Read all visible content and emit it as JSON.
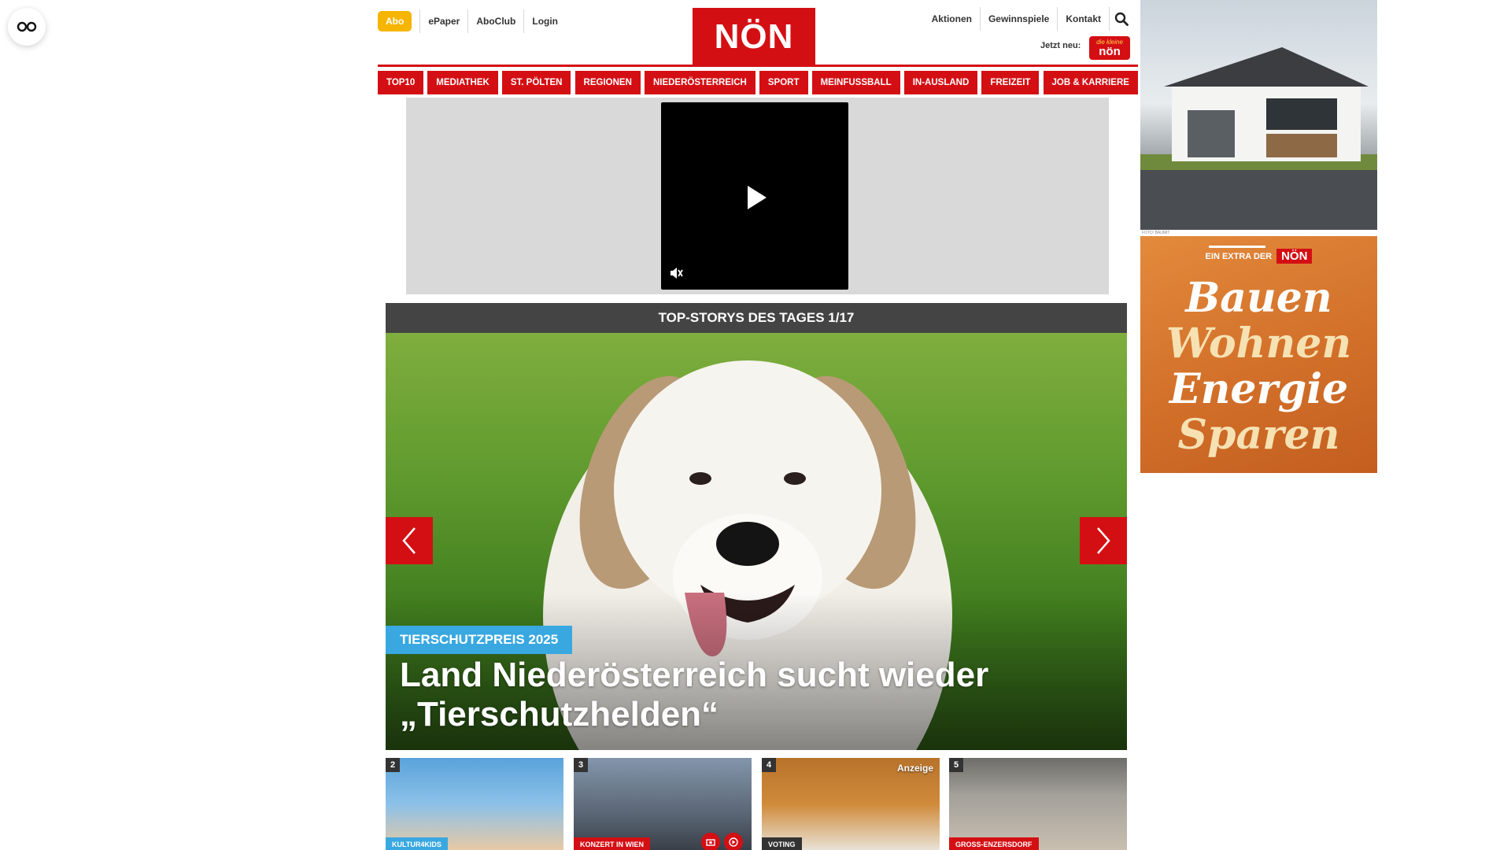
{
  "header": {
    "abo_label": "Abo",
    "top_links": [
      "ePaper",
      "AboClub",
      "Login"
    ],
    "logo_text": "NÖN",
    "right_links": [
      "Aktionen",
      "Gewinnspiele",
      "Kontakt"
    ],
    "jetzt_neu": "Jetzt neu:",
    "badge_small": "die kleine",
    "badge_big": "nön"
  },
  "nav": {
    "items": [
      "TOP10",
      "MEDIATHEK",
      "ST. PÖLTEN",
      "REGIONEN",
      "NIEDERÖSTERREICH",
      "SPORT",
      "MEINFUSSBALL",
      "IN-AUSLAND",
      "FREIZEIT",
      "JOB & KARRIERE"
    ]
  },
  "slider": {
    "heading": "TOP-STORYS DES TAGES 1/17",
    "kicker": "TIERSCHUTZPREIS 2025",
    "headline": "Land Niederösterreich sucht wieder „Tierschutzhelden“"
  },
  "thumbs": [
    {
      "number": "2",
      "tag": "KULTUR4KIDS",
      "tag_color": "#39a8e0"
    },
    {
      "number": "3",
      "tag": "KONZERT IN WIEN",
      "tag_color": "#d40f14"
    },
    {
      "number": "4",
      "tag": "VOTING",
      "tag_color": "#333333",
      "anzeige": "Anzeige"
    },
    {
      "number": "5",
      "tag": "GROSS-ENZERSDORF",
      "tag_color": "#d40f14"
    }
  ],
  "ads": {
    "credit": "FOTO: BAUMIT",
    "extra_text": "EIN EXTRA DER",
    "extra_logo": "NÖN",
    "words": [
      "Bauen",
      "Wohnen",
      "Energie",
      "Sparen"
    ]
  },
  "colors": {
    "brand": "#d40f14",
    "abo": "#f6b500",
    "kicker": "#39a8e0"
  }
}
